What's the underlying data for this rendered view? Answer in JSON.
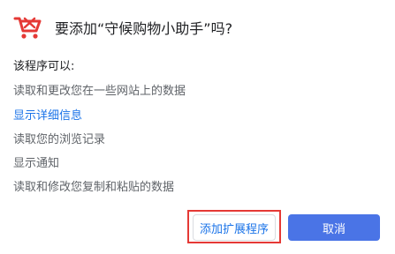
{
  "dialog": {
    "title": "要添加“守候购物小助手”吗?",
    "icon": "shopping-cart-icon",
    "icon_color": "#e53935",
    "permissions_heading": "该程序可以:",
    "permissions": [
      "读取和更改您在一些网站上的数据",
      "显示详细信息",
      "读取您的浏览记录",
      "显示通知",
      "读取和修改您复制和粘贴的数据"
    ],
    "add_button_label": "添加扩展程序",
    "cancel_button_label": "取消",
    "link_color": "#1a73e8",
    "primary_color": "#4a74e6",
    "highlight_color": "#e53935"
  }
}
